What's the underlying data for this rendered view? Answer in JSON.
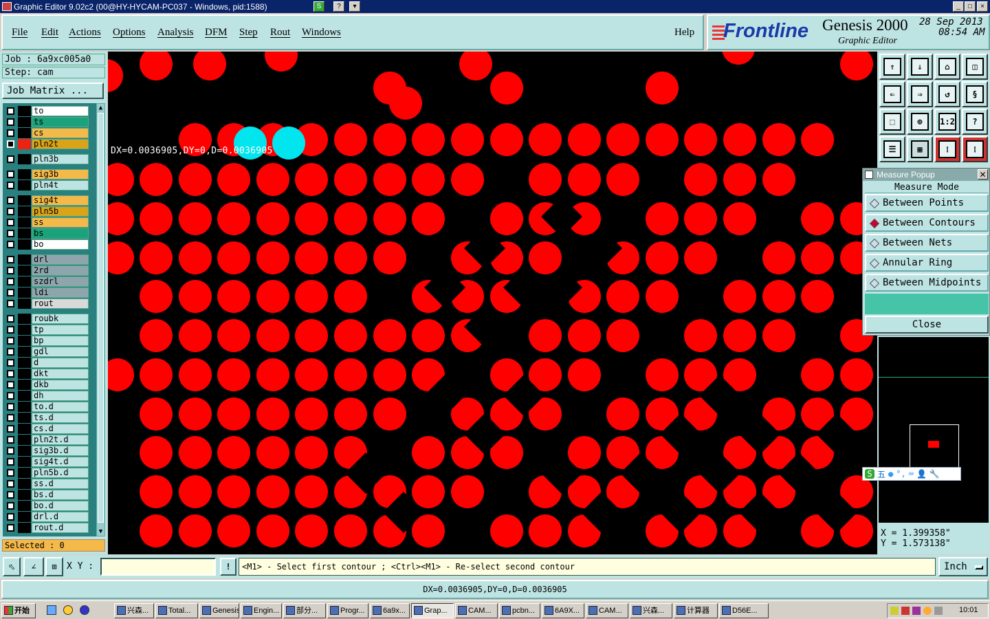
{
  "window": {
    "title": "Graphic Editor 9.02c2 (00@HY-HYCAM-PC037 - Windows, pid:1588)",
    "controls": [
      "_",
      "□",
      "×"
    ]
  },
  "menu": [
    "File",
    "Edit",
    "Actions",
    "Options",
    "Analysis",
    "DFM",
    "Step",
    "Rout",
    "Windows"
  ],
  "help_label": "Help",
  "brand": {
    "logo": "Frontline",
    "product": "Genesis 2000",
    "subtitle": "Graphic Editor",
    "date": "28 Sep 2013",
    "time": "08:54 AM"
  },
  "job": {
    "job_label": "Job : 6a9xc005a0",
    "step_label": "Step: cam",
    "matrix_button": "Job Matrix ..."
  },
  "layers": [
    {
      "name": "to",
      "color": "#ffffff",
      "marker": ""
    },
    {
      "name": "ts",
      "color": "#1aa37a",
      "marker": ""
    },
    {
      "name": "cs",
      "color": "#f5b94a",
      "marker": ""
    },
    {
      "name": "pln2t",
      "color": "#d9a418",
      "marker": "⊞",
      "active": true
    },
    {
      "name": "pln3b",
      "color": "#bde3e3",
      "marker": ""
    },
    {
      "name": "sig3b",
      "color": "#f5b94a",
      "marker": ""
    },
    {
      "name": "pln4t",
      "color": "#bde3e3",
      "marker": ""
    },
    {
      "name": "sig4t",
      "color": "#f5b94a",
      "marker": ""
    },
    {
      "name": "pln5b",
      "color": "#d9a418",
      "marker": ""
    },
    {
      "name": "ss",
      "color": "#f5b94a",
      "marker": ""
    },
    {
      "name": "bs",
      "color": "#1aa37a",
      "marker": ""
    },
    {
      "name": "bo",
      "color": "#ffffff",
      "marker": ""
    },
    {
      "name": "drl",
      "color": "#8fa5ad",
      "marker": ""
    },
    {
      "name": "2rd",
      "color": "#8fa5ad",
      "marker": ""
    },
    {
      "name": "szdrl",
      "color": "#8fa5ad",
      "marker": ""
    },
    {
      "name": "ldi",
      "color": "#8fa5ad",
      "marker": ""
    },
    {
      "name": "rout",
      "color": "#d9d9d9",
      "marker": ""
    },
    {
      "name": "roubk",
      "color": "#bde3e3",
      "marker": ""
    },
    {
      "name": "tp",
      "color": "#bde3e3",
      "marker": ""
    },
    {
      "name": "bp",
      "color": "#bde3e3",
      "marker": ""
    },
    {
      "name": "gdl",
      "color": "#bde3e3",
      "marker": ""
    },
    {
      "name": "d",
      "color": "#bde3e3",
      "marker": ""
    },
    {
      "name": "dkt",
      "color": "#bde3e3",
      "marker": ""
    },
    {
      "name": "dkb",
      "color": "#bde3e3",
      "marker": ""
    },
    {
      "name": "dh",
      "color": "#bde3e3",
      "marker": ""
    },
    {
      "name": "to.d",
      "color": "#bde3e3",
      "marker": "⬋"
    },
    {
      "name": "ts.d",
      "color": "#bde3e3",
      "marker": ""
    },
    {
      "name": "cs.d",
      "color": "#bde3e3",
      "marker": "⬋"
    },
    {
      "name": "pln2t.d",
      "color": "#bde3e3",
      "marker": ""
    },
    {
      "name": "sig3b.d",
      "color": "#bde3e3",
      "marker": "⬋"
    },
    {
      "name": "sig4t.d",
      "color": "#bde3e3",
      "marker": "⬋"
    },
    {
      "name": "pln5b.d",
      "color": "#bde3e3",
      "marker": ""
    },
    {
      "name": "ss.d",
      "color": "#bde3e3",
      "marker": "⬋"
    },
    {
      "name": "bs.d",
      "color": "#bde3e3",
      "marker": ""
    },
    {
      "name": "bo.d",
      "color": "#bde3e3",
      "marker": ""
    },
    {
      "name": "drl.d",
      "color": "#bde3e3",
      "marker": ""
    },
    {
      "name": "rout.d",
      "color": "#bde3e3",
      "marker": ""
    }
  ],
  "selected_label": "Selected : 0",
  "canvas": {
    "measure_text": "DX=0.0036905,DY=0,D=0.0036905",
    "pad_color": "#ff0000",
    "highlight_color": "#00e5ee"
  },
  "measure_popup": {
    "title": "Measure Popup",
    "header": "Measure Mode",
    "options": [
      {
        "label": "Between Points",
        "selected": false
      },
      {
        "label": "Between Contours",
        "selected": true
      },
      {
        "label": "Between Nets",
        "selected": false
      },
      {
        "label": "Annular Ring",
        "selected": false
      },
      {
        "label": "Between Midpoints",
        "selected": false
      }
    ],
    "close_label": "Close"
  },
  "ime_bar": {
    "items": [
      "S",
      "五",
      "●",
      "°,",
      "⌨",
      "👤",
      "🔧"
    ]
  },
  "cursor": {
    "x": "X = 1.399358\"",
    "y": "Y = 1.573138\""
  },
  "status": {
    "xy_label": "X Y :",
    "xy_value": "",
    "prompt": "<M1> - Select first contour ; <Ctrl><M1> - Re-select second contour",
    "units": "Inch"
  },
  "bottom_readout": "DX=0.0036905,DY=0,D=0.0036905",
  "taskbar": {
    "start": "开始",
    "tasks": [
      "兴森...",
      "Total...",
      "Genesis",
      "Engin...",
      "部分...",
      "Progr...",
      "6a9x...",
      "Grap...",
      "CAM...",
      "pcbn...",
      "6A9X...",
      "CAM...",
      "兴森...",
      "计算器",
      "D56E..."
    ],
    "active_task": 7,
    "clock": "10:01"
  }
}
